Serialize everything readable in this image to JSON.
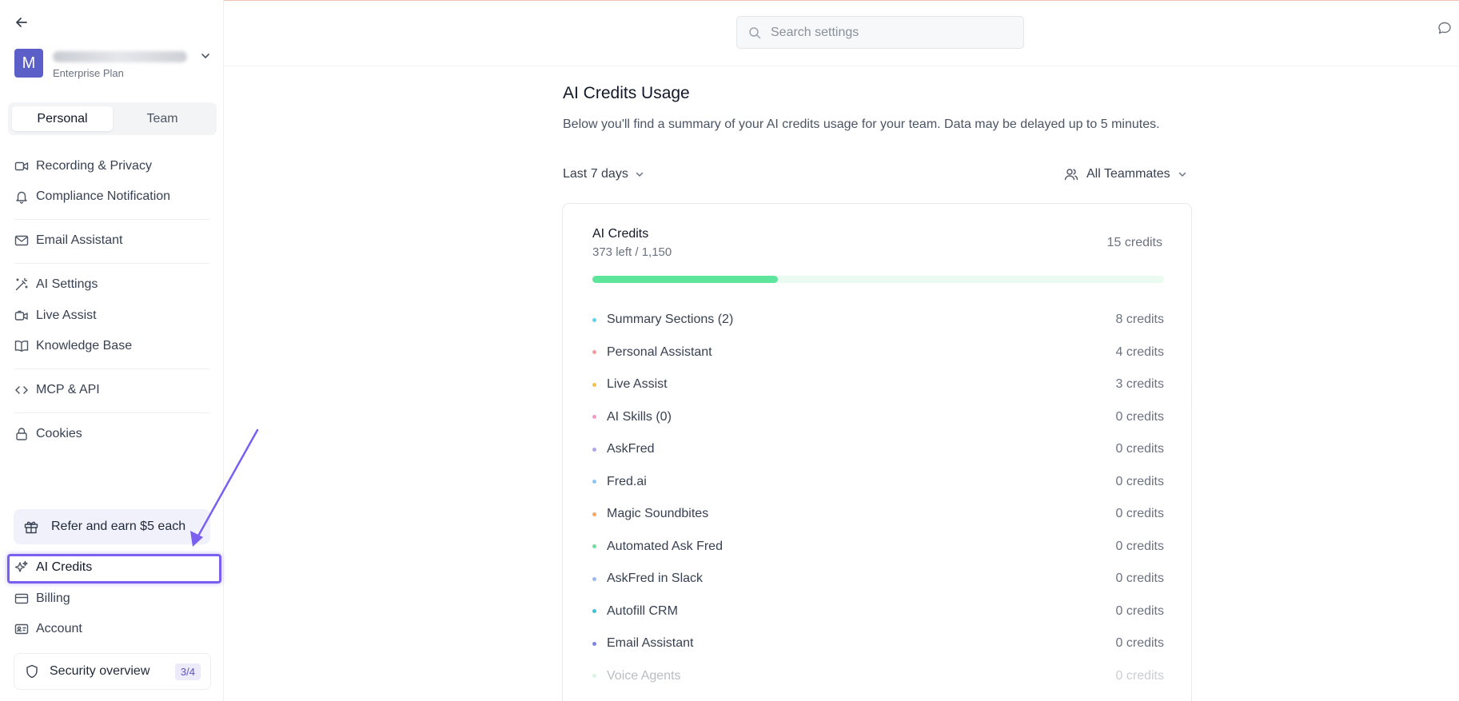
{
  "sidebar": {
    "account": {
      "avatar_letter": "M",
      "plan": "Enterprise Plan"
    },
    "tabs": [
      {
        "label": "Personal",
        "active": true
      },
      {
        "label": "Team",
        "active": false
      }
    ],
    "items": [
      {
        "label": "Recording & Privacy",
        "icon": "video-icon"
      },
      {
        "label": "Compliance Notification",
        "icon": "bell-icon"
      },
      {
        "label": "Email Assistant",
        "icon": "mail-icon"
      },
      {
        "label": "AI Settings",
        "icon": "magic-wand-icon"
      },
      {
        "label": "Live Assist",
        "icon": "live-assist-icon"
      },
      {
        "label": "Knowledge Base",
        "icon": "book-icon"
      },
      {
        "label": "MCP & API",
        "icon": "code-icon"
      },
      {
        "label": "Cookies",
        "icon": "lock-icon"
      }
    ],
    "refer_label": "Refer and earn $5 each",
    "bottom_items": [
      {
        "label": "AI Credits",
        "icon": "sparkles-icon"
      },
      {
        "label": "Billing",
        "icon": "credit-card-icon"
      },
      {
        "label": "Account",
        "icon": "id-card-icon"
      }
    ],
    "security": {
      "label": "Security overview",
      "badge": "3/4"
    }
  },
  "header": {
    "search_placeholder": "Search settings"
  },
  "main": {
    "title": "AI Credits Usage",
    "description": "Below you'll find a summary of your AI credits usage for your team. Data may be delayed up to 5 minutes.",
    "date_range": "Last 7 days",
    "teammates_filter": "All Teammates",
    "card": {
      "title": "AI Credits",
      "subtitle": "373 left / 1,150",
      "total": "15 credits",
      "progress_fraction": 0.325,
      "rows": [
        {
          "name": "Summary Sections (2)",
          "value": "8 credits",
          "dot": "#5fd3ea"
        },
        {
          "name": "Personal Assistant",
          "value": "4 credits",
          "dot": "#f59a9a"
        },
        {
          "name": "Live Assist",
          "value": "3 credits",
          "dot": "#f5c04a"
        },
        {
          "name": "AI Skills (0)",
          "value": "0 credits",
          "dot": "#f49ac7"
        },
        {
          "name": "AskFred",
          "value": "0 credits",
          "dot": "#b3a4e6"
        },
        {
          "name": "Fred.ai",
          "value": "0 credits",
          "dot": "#8cc7f2"
        },
        {
          "name": "Magic Soundbites",
          "value": "0 credits",
          "dot": "#f6a864"
        },
        {
          "name": "Automated Ask Fred",
          "value": "0 credits",
          "dot": "#6fdca0"
        },
        {
          "name": "AskFred in Slack",
          "value": "0 credits",
          "dot": "#9fb8ea"
        },
        {
          "name": "Autofill CRM",
          "value": "0 credits",
          "dot": "#3cc3d8"
        },
        {
          "name": "Email Assistant",
          "value": "0 credits",
          "dot": "#7b86e6"
        },
        {
          "name": "Voice Agents",
          "value": "0 credits",
          "dot": "#8fe0b6"
        }
      ]
    }
  },
  "colors": {
    "accent": "#5b5fc7",
    "highlight": "#7a5ff0",
    "progress": "#5ee59c"
  }
}
